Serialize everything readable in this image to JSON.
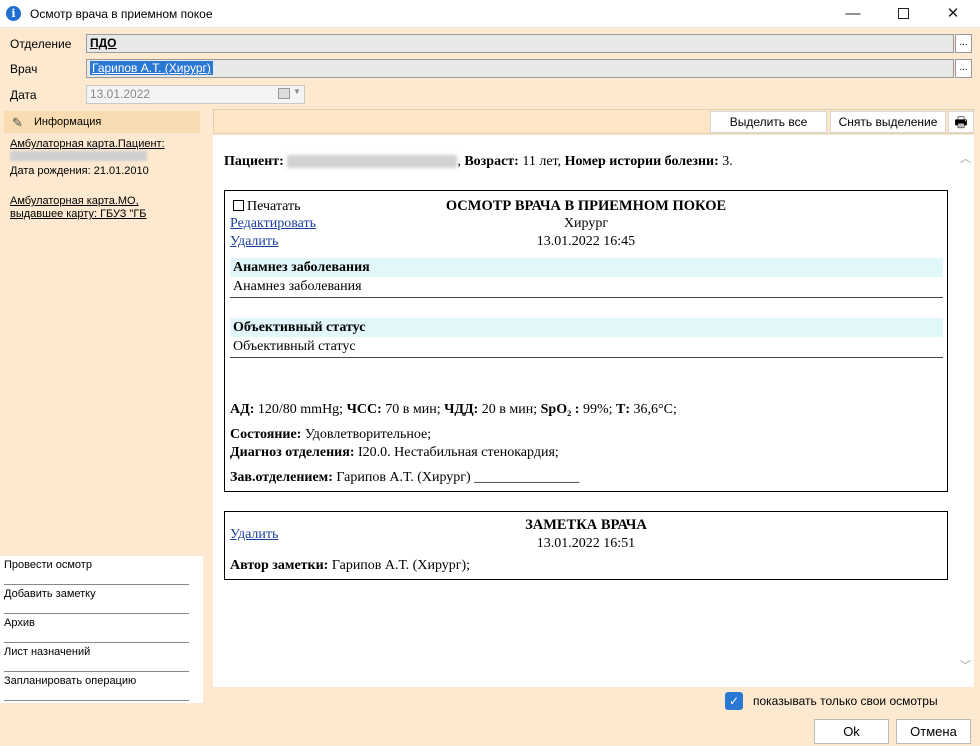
{
  "window": {
    "title": "Осмотр врача в приемном покое",
    "minimize": "—",
    "close": "✕"
  },
  "form": {
    "department_label": "Отделение",
    "department_value": "ПДО",
    "doctor_label": "Врач",
    "doctor_value": "Гарипов А.Т. (Хирург)",
    "date_label": "Дата",
    "date_value": "13.01.2022",
    "browse": "..."
  },
  "sidebar": {
    "info_header": "Информация",
    "card_link": "Амбулаторная карта.Пациент:",
    "birth": "Дата рождения: 21.01.2010",
    "mo_link_1": "Амбулаторная карта.МО,",
    "mo_link_2": "выдавшее карту: ГБУЗ \"ГБ"
  },
  "actions": [
    "Провести осмотр",
    "Добавить заметку",
    "Архив",
    "Лист назначений",
    "Запланировать операцию"
  ],
  "toolbar": {
    "select_all": "Выделить все",
    "deselect": "Снять выделение",
    "print_icon": "🖶"
  },
  "document": {
    "patient_label": "Пациент:",
    "age_label": "Возраст:",
    "age_value": "11 лет,",
    "history_label": "Номер истории болезни:",
    "history_value": "3.",
    "exam": {
      "print_label": "Печатать",
      "title": "ОСМОТР ВРАЧА В ПРИЕМНОМ ПОКОЕ",
      "specialty": "Хирург",
      "edit": "Редактировать",
      "delete": "Удалить",
      "datetime": "13.01.2022 16:45",
      "anamnesis_head": "Анамнез заболевания",
      "anamnesis_text": "Анамнез заболевания",
      "objective_head": "Объективный статус",
      "objective_text": "Объективный статус",
      "vitals": [
        {
          "label": "АД:",
          "value": "120/80 mmHg;"
        },
        {
          "label": "ЧСС:",
          "value": "70 в мин;"
        },
        {
          "label": "ЧДД:",
          "value": "20 в мин;"
        },
        {
          "label": "SpO₂ :",
          "value": "99%;"
        },
        {
          "label": "Т:",
          "value": "36,6°С;"
        }
      ],
      "condition_label": "Состояние:",
      "condition_value": "Удовлетворительное;",
      "diagnosis_label": "Диагноз отделения:",
      "diagnosis_value": "I20.0. Нестабильная стенокардия;",
      "head_label": "Зав.отделением:",
      "head_value": "Гарипов А.Т. (Хирург) _______________"
    },
    "note": {
      "title": "ЗАМЕТКА ВРАЧА",
      "delete": "Удалить",
      "datetime": "13.01.2022 16:51",
      "author_label": "Автор заметки:",
      "author_value": "Гарипов А.Т. (Хирург);"
    }
  },
  "footer": {
    "only_own": "показывать только свои осмотры",
    "ok": "Ok",
    "cancel": "Отмена"
  },
  "colors": {
    "accent": "#2a78d4",
    "panel": "#fde9cf",
    "section": "#e2f7fa"
  }
}
